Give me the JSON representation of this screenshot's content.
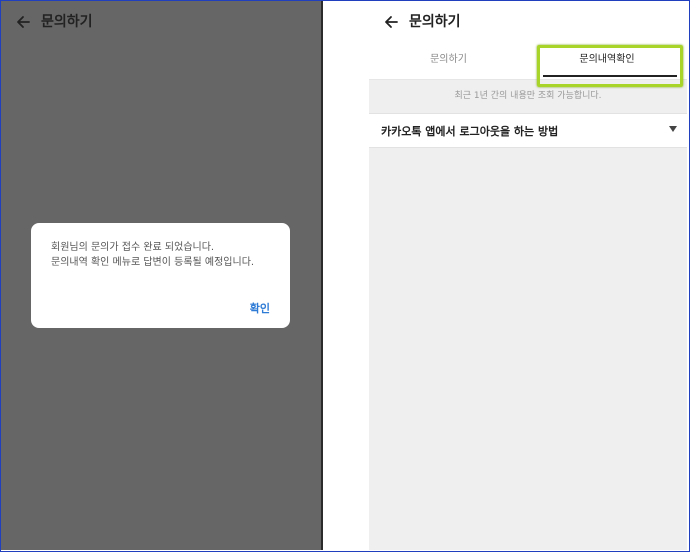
{
  "left_screen": {
    "header": {
      "title": "문의하기"
    },
    "dialog": {
      "message_line1": "회원님의 문의가 접수 완료 되었습니다.",
      "message_line2": "문의내역 확인 메뉴로 답변이 등록될 예정입니다.",
      "confirm_label": "확인"
    }
  },
  "right_screen": {
    "header": {
      "title": "문의하기"
    },
    "tabs": [
      {
        "label": "문의하기",
        "active": false
      },
      {
        "label": "문의내역확인",
        "active": true
      }
    ],
    "notice": "최근 1년 간의 내용만 조회 가능합니다.",
    "items": [
      {
        "title": "카카오톡 앱에서 로그아웃을 하는 방법"
      }
    ]
  },
  "colors": {
    "overlay": "#666666",
    "link_blue": "#2e7bd6",
    "highlight": "#a8d42a",
    "content_bg": "#efefef"
  }
}
